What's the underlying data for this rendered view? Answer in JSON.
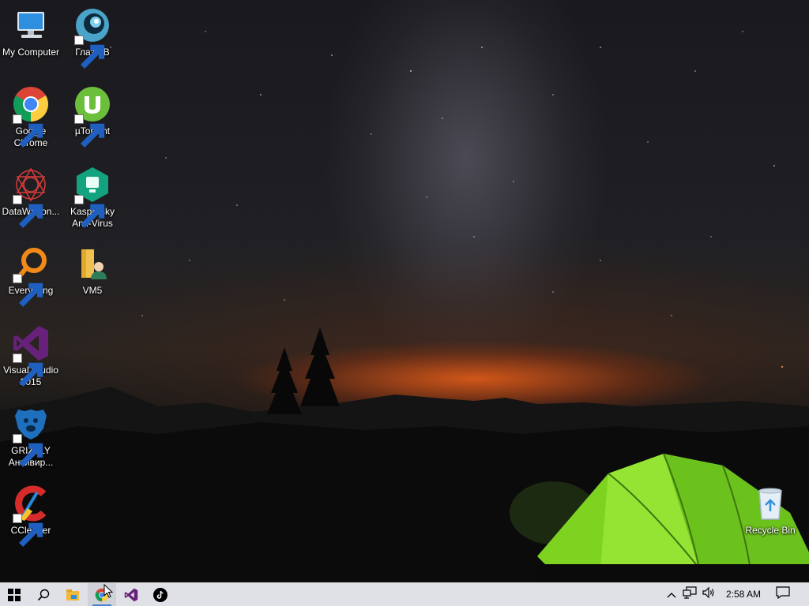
{
  "desktop": {
    "icons": [
      {
        "label": "My Computer",
        "icon": "computer-icon"
      },
      {
        "label": "Глаз.ТВ",
        "icon": "glaz-tv-icon"
      },
      {
        "label": "Google Chrome",
        "icon": "chrome-icon"
      },
      {
        "label": "µTorrent",
        "icon": "utorrent-icon"
      },
      {
        "label": "DataWagon...",
        "icon": "datawagon-icon"
      },
      {
        "label": "Kaspersky Anti-Virus",
        "icon": "kaspersky-icon"
      },
      {
        "label": "Everything",
        "icon": "everything-search-icon"
      },
      {
        "label": "VM5",
        "icon": "folder-user-icon"
      },
      {
        "label": "Visual Studio 2015",
        "icon": "visual-studio-icon"
      },
      {
        "label": "GRIZZLY Антивир...",
        "icon": "grizzly-bear-icon"
      },
      {
        "label": "CCleaner",
        "icon": "ccleaner-icon"
      },
      {
        "label": "Recycle Bin",
        "icon": "recycle-bin-icon"
      }
    ]
  },
  "taskbar": {
    "buttons": [
      {
        "name": "start-button",
        "icon": "windows-logo-icon"
      },
      {
        "name": "search-button",
        "icon": "search-icon"
      },
      {
        "name": "file-explorer-button",
        "icon": "file-explorer-icon"
      },
      {
        "name": "chrome-taskbar-button",
        "icon": "chrome-icon",
        "active": true
      },
      {
        "name": "visual-studio-taskbar-button",
        "icon": "visual-studio-icon"
      },
      {
        "name": "tiktok-taskbar-button",
        "icon": "tiktok-icon"
      }
    ],
    "tray": {
      "icons": [
        "show-hidden-icons-chevron",
        "network-icon",
        "volume-icon"
      ],
      "clock": "2:58 AM",
      "notification_icon": "action-center-icon"
    }
  },
  "colors": {
    "taskbar_bg": "#dfe1e6",
    "tent_green": "#7ed321",
    "horizon_orange": "#e85f19"
  }
}
